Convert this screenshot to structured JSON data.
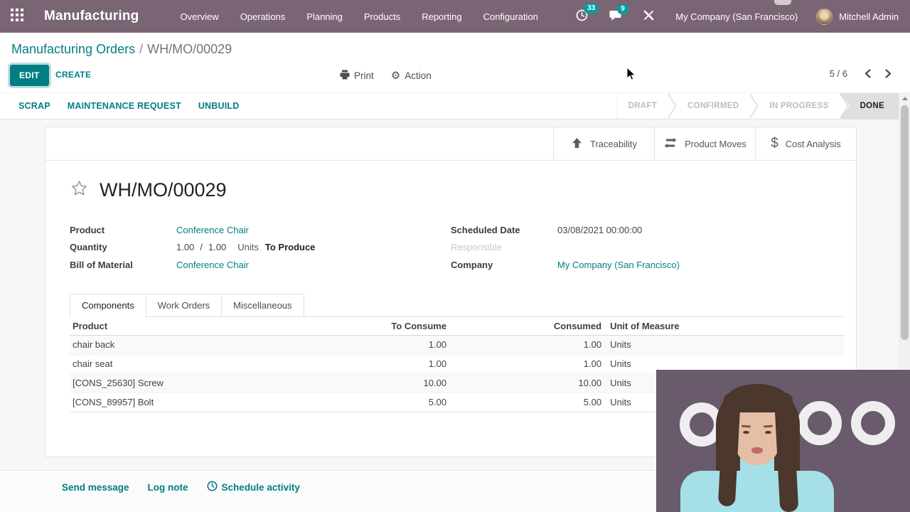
{
  "navbar": {
    "app_name": "Manufacturing",
    "menu": [
      "Overview",
      "Operations",
      "Planning",
      "Products",
      "Reporting",
      "Configuration"
    ],
    "activity_badge": "33",
    "message_badge": "9",
    "company_name": "My Company (San Francisco)",
    "user_name": "Mitchell Admin"
  },
  "breadcrumb": {
    "parent": "Manufacturing Orders",
    "separator": "/",
    "current": "WH/MO/00029"
  },
  "control_panel": {
    "edit": "EDIT",
    "create": "CREATE",
    "print": "Print",
    "action": "Action",
    "pager": "5 / 6"
  },
  "action_buttons": [
    "SCRAP",
    "MAINTENANCE REQUEST",
    "UNBUILD"
  ],
  "statusbar": [
    "DRAFT",
    "CONFIRMED",
    "IN PROGRESS",
    "DONE"
  ],
  "statusbar_active": "DONE",
  "smart_buttons": [
    {
      "label": "Traceability",
      "icon": "arrow-up-icon"
    },
    {
      "label": "Product Moves",
      "icon": "exchange-icon"
    },
    {
      "label": "Cost Analysis",
      "icon": "dollar-icon"
    }
  ],
  "record": {
    "title": "WH/MO/00029",
    "product_label": "Product",
    "product_value": "Conference Chair",
    "quantity_label": "Quantity",
    "quantity_done": "1.00",
    "quantity_sep": "/",
    "quantity_total": "1.00",
    "quantity_uom": "Units",
    "quantity_suffix": "To Produce",
    "bom_label": "Bill of Material",
    "bom_value": "Conference Chair",
    "scheduled_label": "Scheduled Date",
    "scheduled_value": "03/08/2021 00:00:00",
    "responsible_label": "Responsible",
    "company_label": "Company",
    "company_value": "My Company (San Francisco)"
  },
  "tabs": [
    "Components",
    "Work Orders",
    "Miscellaneous"
  ],
  "components_table": {
    "headers": [
      "Product",
      "To Consume",
      "Consumed",
      "Unit of Measure"
    ],
    "rows": [
      [
        "chair back",
        "1.00",
        "1.00",
        "Units"
      ],
      [
        "chair seat",
        "1.00",
        "1.00",
        "Units"
      ],
      [
        "[CONS_25630] Screw",
        "10.00",
        "10.00",
        "Units"
      ],
      [
        "[CONS_89957] Bolt",
        "5.00",
        "5.00",
        "Units"
      ]
    ]
  },
  "chatter": {
    "send_message": "Send message",
    "log_note": "Log note",
    "schedule_activity": "Schedule activity"
  },
  "colors": {
    "accent_teal": "#017e84",
    "badge_teal": "#00a09d",
    "navbar_bg": "#7a6574",
    "done_bg": "#dfdfdf"
  }
}
